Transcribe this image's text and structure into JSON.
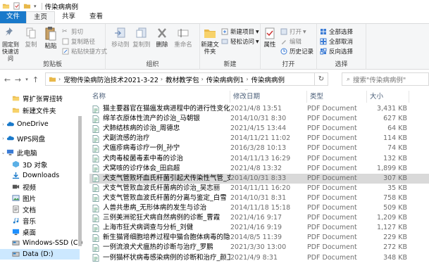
{
  "window": {
    "title": "传染病病例"
  },
  "tabs": [
    {
      "label": "文件"
    },
    {
      "label": "主页"
    },
    {
      "label": "共享"
    },
    {
      "label": "查看"
    }
  ],
  "ribbon": {
    "clipboard": {
      "label": "剪贴板",
      "pin_quick": "固定到快速访问",
      "copy": "复制",
      "paste": "粘贴",
      "cut": "剪切",
      "copy_path": "复制路径",
      "paste_shortcut": "粘贴快捷方式"
    },
    "organize": {
      "label": "组织",
      "move_to": "移动到",
      "copy_to": "复制到",
      "delete": "删除",
      "rename": "重命名"
    },
    "new": {
      "label": "新建",
      "new_folder": "新建文件夹",
      "new_item": "新建项目",
      "easy_access": "轻松访问"
    },
    "open": {
      "label": "打开",
      "properties": "属性",
      "open": "打开",
      "edit": "编辑",
      "history": "历史记录"
    },
    "select": {
      "label": "选择",
      "select_all": "全部选择",
      "select_none": "全部取消",
      "invert": "反向选择"
    }
  },
  "address": {
    "crumbs": [
      "宠物传染病防治技术2021-3-22",
      "教材教学包",
      "传染病病例1",
      "传染病病例"
    ],
    "search_placeholder": "搜索\"传染病病例\""
  },
  "columns": {
    "name": "名称",
    "date": "修改日期",
    "type": "类型",
    "size": "大小"
  },
  "nav": [
    {
      "label": "胃扩张胃扭转",
      "icon": "folder-icon",
      "indent": 1
    },
    {
      "label": "新建文件夹",
      "icon": "folder-icon",
      "indent": 1
    },
    {
      "label": "OneDrive",
      "icon": "cloud-icon",
      "indent": 0
    },
    {
      "label": "WPS网盘",
      "icon": "cloud-icon",
      "indent": 0
    },
    {
      "label": "此电脑",
      "icon": "computer-icon",
      "indent": 0
    },
    {
      "label": "3D 对象",
      "icon": "cube-icon",
      "indent": 1
    },
    {
      "label": "Downloads",
      "icon": "download-icon",
      "indent": 1
    },
    {
      "label": "视频",
      "icon": "video-icon",
      "indent": 1
    },
    {
      "label": "图片",
      "icon": "picture-icon",
      "indent": 1
    },
    {
      "label": "文档",
      "icon": "document-icon",
      "indent": 1
    },
    {
      "label": "音乐",
      "icon": "music-icon",
      "indent": 1
    },
    {
      "label": "桌面",
      "icon": "desktop-icon",
      "indent": 1
    },
    {
      "label": "Windows-SSD (C:)",
      "icon": "drive-icon",
      "indent": 1
    },
    {
      "label": "Data (D:)",
      "icon": "drive-icon",
      "indent": 1
    }
  ],
  "files": [
    {
      "name": "猫主要器官在猫瘟发病进程中的进行性变化_谢赣",
      "date": "2021/4/8 13:51",
      "type": "PDF Document",
      "size": "3,431 KB"
    },
    {
      "name": "绵羊衣原体性流产的诊治_马朝银",
      "date": "2014/10/31 8:30",
      "type": "PDF Document",
      "size": "627 KB"
    },
    {
      "name": "犬肺结核病的诊治_周德忠",
      "date": "2021/4/15 13:44",
      "type": "PDF Document",
      "size": "64 KB"
    },
    {
      "name": "犬副流感的治疗",
      "date": "2014/11/21 11:02",
      "type": "PDF Document",
      "size": "114 KB"
    },
    {
      "name": "犬瘟疹病毒诊疗一例_孙宁",
      "date": "2016/3/28 10:13",
      "type": "PDF Document",
      "size": "74 KB"
    },
    {
      "name": "犬肉毒梭菌毒素中毒的诊治",
      "date": "2014/11/13 16:29",
      "type": "PDF Document",
      "size": "132 KB"
    },
    {
      "name": "犬窝咳的诊疗体会_田启超",
      "date": "2021/4/8 13:32",
      "type": "PDF Document",
      "size": "1,899 KB"
    },
    {
      "name": "犬支气管败坏血氏杆菌引起犬传染性气管_支...",
      "date": "2014/10/31 8:33",
      "type": "PDF Document",
      "size": "307 KB"
    },
    {
      "name": "犬支气管败血波氏杆菌病的诊治_吴志丽",
      "date": "2014/11/11 16:20",
      "type": "PDF Document",
      "size": "35 KB"
    },
    {
      "name": "犬支气管败血波氏杆菌的分离与鉴定_白雪",
      "date": "2014/10/31 8:31",
      "type": "PDF Document",
      "size": "758 KB"
    },
    {
      "name": "人兽共患病_无形体病的发生与诊治",
      "date": "2014/11/18 15:18",
      "type": "PDF Document",
      "size": "509 KB"
    },
    {
      "name": "三例美洲驼狂犬病自然病例的诊断_曹霞",
      "date": "2021/4/16 9:17",
      "type": "PDF Document",
      "size": "1,209 KB"
    },
    {
      "name": "上海市狂犬病调查与分析_刘健",
      "date": "2021/4/16 9:19",
      "type": "PDF Document",
      "size": "1,127 KB"
    },
    {
      "name": "新生猫肾细胞培养过程中猫合胞体病毒的隐性感...",
      "date": "2014/8/5 11:39",
      "type": "PDF Document",
      "size": "229 KB"
    },
    {
      "name": "一例流浪犬犬瘟热的诊断与治疗_罗鹏",
      "date": "2021/3/30 13:00",
      "type": "PDF Document",
      "size": "272 KB"
    },
    {
      "name": "一例猫杯状病毒感染病例的诊断和治疗_颜卫",
      "date": "2021/4/9 8:31",
      "type": "PDF Document",
      "size": "348 KB"
    }
  ],
  "selected_index": 7
}
